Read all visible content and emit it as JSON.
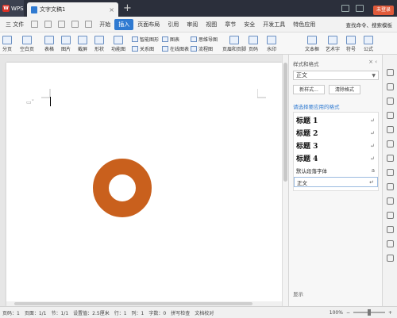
{
  "titlebar": {
    "app_name": "WPS",
    "doc_tab": "文字文稿1",
    "new_tab": "+",
    "login": "未登录"
  },
  "menu": {
    "file": "三 文件",
    "items": [
      "开始",
      "插入",
      "页面布局",
      "引用",
      "审阅",
      "视图",
      "章节",
      "安全",
      "开发工具",
      "特色应用"
    ],
    "active": "插入",
    "search": "查找命令、搜索模板"
  },
  "ribbon": {
    "page_break": "分页",
    "blank_page": "空白页",
    "table": "表格",
    "picture": "图片",
    "screenshot": "截屏",
    "shape": "形状",
    "icon_lib": "功能图",
    "smart_shape": "智能图形",
    "chart": "图表",
    "mind_map": "思维导图",
    "relation": "关系图",
    "online_chart": "在线图表",
    "flowchart": "流程图",
    "header_footer": "页眉和页脚",
    "page_number": "页码",
    "watermark": "水印",
    "textbox": "文本框",
    "wordart": "艺术字",
    "symbol": "符号",
    "formula": "公式"
  },
  "panel": {
    "title": "样式和格式",
    "current_style": "正文",
    "new_style": "新样式...",
    "clear_format": "清除格式",
    "apply_label": "请选择要应用的格式",
    "styles": [
      {
        "label": "标题 1",
        "kind": "h"
      },
      {
        "label": "标题 2",
        "kind": "h"
      },
      {
        "label": "标题 3",
        "kind": "h"
      },
      {
        "label": "标题 4",
        "kind": "h"
      },
      {
        "label": "默认段落字体",
        "kind": "n"
      },
      {
        "label": "正文",
        "kind": "n"
      }
    ],
    "show": "显示"
  },
  "shape": {
    "type": "donut",
    "fill": "#c9601d"
  },
  "status": {
    "page_count": "页码：1",
    "pages": "页面：1/1",
    "section": "节：1/1",
    "setting": "设置值：2.5厘米",
    "row": "行：1",
    "col": "列：1",
    "words": "字数：0",
    "spell": "拼写检查",
    "doc_check": "文档校对",
    "zoom": "100%"
  }
}
